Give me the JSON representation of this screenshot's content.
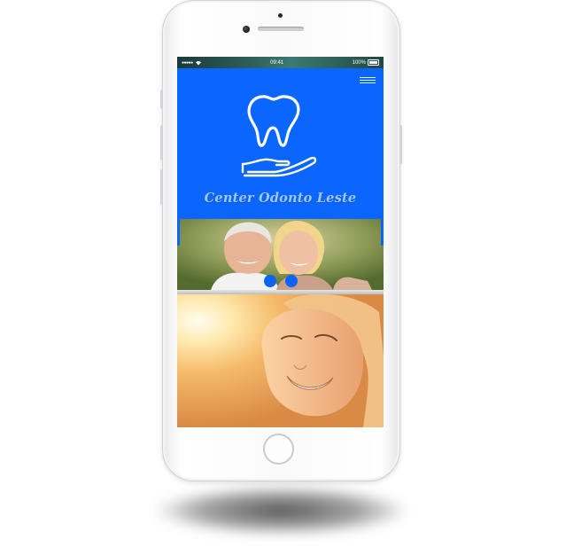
{
  "status_bar": {
    "signal": "●●●●●",
    "time": "09:41",
    "battery": "100%"
  },
  "header": {
    "brand_name": "Center Odonto Leste",
    "menu_icon": "hamburger-menu-icon",
    "logo_icon": "tooth-in-hand-icon",
    "background_color": "#0b66ff"
  },
  "slider": {
    "image": "smiling-elderly-couple",
    "dots": 2,
    "dot_color": "#0d63f5"
  },
  "banner": {
    "image": "smiling-woman-in-sunlight"
  }
}
